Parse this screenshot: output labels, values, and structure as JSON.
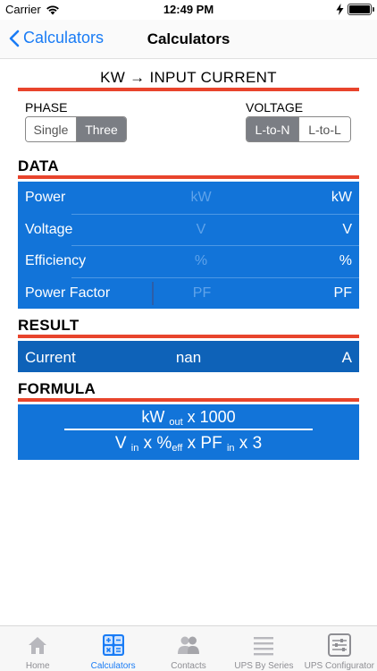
{
  "status_bar": {
    "carrier": "Carrier",
    "time": "12:49 PM"
  },
  "nav": {
    "back_label": "Calculators",
    "title": "Calculators"
  },
  "calculator": {
    "title": "KW → INPUT CURRENT",
    "phase": {
      "label": "PHASE",
      "options": [
        "Single",
        "Three"
      ],
      "selected": "Three"
    },
    "voltage": {
      "label": "VOLTAGE",
      "options": [
        "L-to-N",
        "L-to-L"
      ],
      "selected": "L-to-N"
    }
  },
  "data_section": {
    "heading": "DATA",
    "rows": [
      {
        "label": "Power",
        "placeholder": "kW",
        "value": "",
        "unit": "kW"
      },
      {
        "label": "Voltage",
        "placeholder": "V",
        "value": "",
        "unit": "V"
      },
      {
        "label": "Efficiency",
        "placeholder": "%",
        "value": "",
        "unit": "%"
      },
      {
        "label": "Power Factor",
        "placeholder": "PF",
        "value": "",
        "unit": "PF"
      }
    ]
  },
  "result_section": {
    "heading": "RESULT",
    "label": "Current",
    "value": "nan",
    "unit": "A"
  },
  "formula_section": {
    "heading": "FORMULA",
    "numerator": {
      "a": "kW ",
      "a_sub": "out",
      "b": " x 1000"
    },
    "denominator": {
      "a": "V ",
      "a_sub": "in",
      "b": " x %",
      "b_sub": "eff",
      "c": " x PF ",
      "c_sub": "in",
      "d": " x 3"
    }
  },
  "tab_bar": {
    "tabs": [
      {
        "label": "Home",
        "icon": "home-icon",
        "active": false
      },
      {
        "label": "Calculators",
        "icon": "calculator-icon",
        "active": true
      },
      {
        "label": "Contacts",
        "icon": "contacts-icon",
        "active": false
      },
      {
        "label": "UPS By Series",
        "icon": "list-icon",
        "active": false
      },
      {
        "label": "UPS Configurator",
        "icon": "configurator-icon",
        "active": false
      }
    ]
  },
  "colors": {
    "accent": "#1a7cf5",
    "panel_blue": "#1274d9",
    "result_blue": "#0e62b8",
    "rule_red": "#e8442c",
    "segment_active": "#7b7e84"
  }
}
